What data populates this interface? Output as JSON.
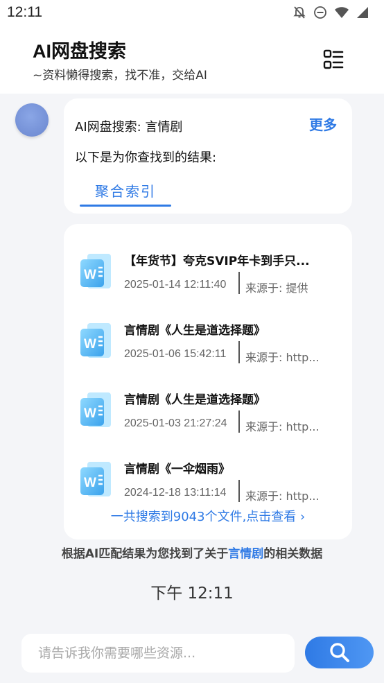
{
  "status_bar": {
    "time": "12:11"
  },
  "header": {
    "title": "AI网盘搜索",
    "subtitle": "~资料懒得搜索，找不准，交给AI"
  },
  "result_card": {
    "title": "AI网盘搜索: 言情剧",
    "more_label": "更多",
    "description": "以下是为你查找到的结果:",
    "tab_label": "聚合索引"
  },
  "files": [
    {
      "name": "【年货节】夸克SVIP年卡到手只...",
      "date": "2025-01-14 12:11:40",
      "source": "来源于: 提供"
    },
    {
      "name": "言情剧《人生是道选择题》",
      "date": "2025-01-06 15:42:11",
      "source": "来源于: http..."
    },
    {
      "name": "言情剧《人生是道选择题》",
      "date": "2025-01-03 21:27:24",
      "source": "来源于: http..."
    },
    {
      "name": "言情剧《一伞烟雨》",
      "date": "2024-12-18 13:11:14",
      "source": "来源于: http..."
    }
  ],
  "total_link": "一共搜索到9043个文件,点击查看 ›",
  "footnote": {
    "prefix": "根据AI匹配结果为您找到了关于",
    "keyword": "言情剧",
    "suffix": "的相关数据"
  },
  "message_time": "下午 12:11",
  "search": {
    "placeholder": "请告诉我你需要哪些资源..."
  },
  "colors": {
    "accent": "#2f7ae5",
    "background": "#f4f5f8"
  },
  "icons": [
    "notifications-off-icon",
    "do-not-disturb-icon",
    "wifi-icon",
    "signal-icon",
    "menu-list-icon",
    "word-doc-icon",
    "search-icon",
    "chevron-right-icon"
  ]
}
